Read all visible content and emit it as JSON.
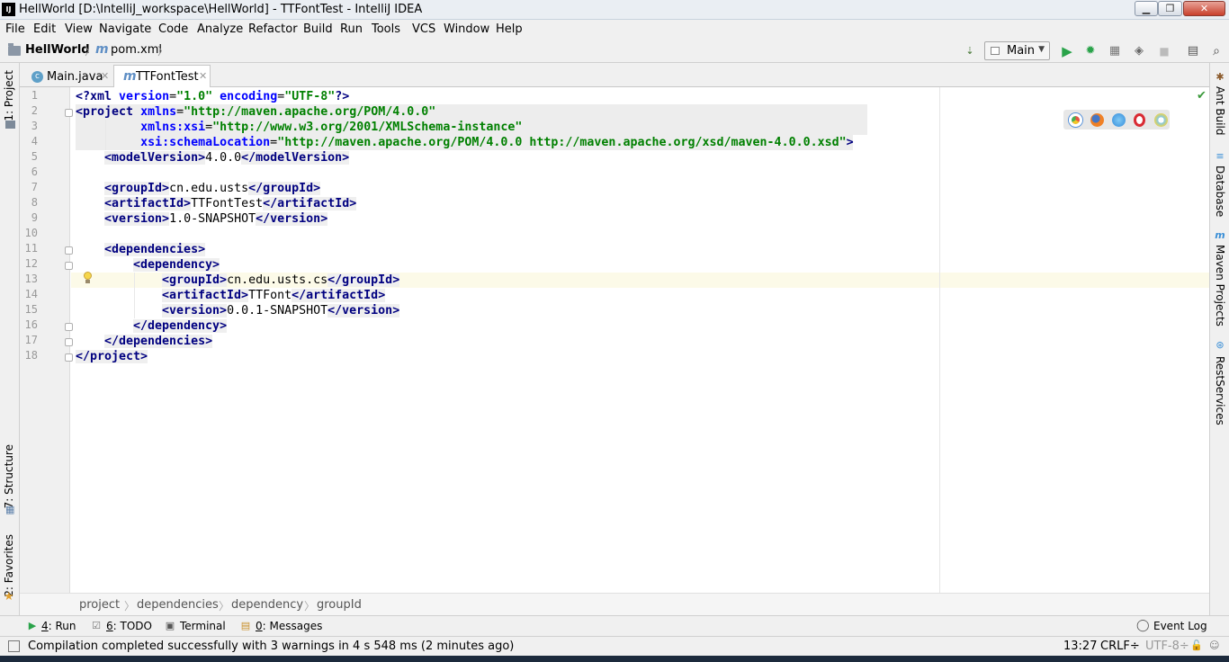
{
  "window": {
    "app_icon": "IJ",
    "title": "HellWorld [D:\\IntelliJ_workspace\\HellWorld] - TTFontTest - IntelliJ IDEA",
    "controls": [
      "minimize-icon",
      "maximize-icon",
      "close-icon"
    ]
  },
  "menu": {
    "items": [
      "File",
      "Edit",
      "View",
      "Navigate",
      "Code",
      "Analyze",
      "Refactor",
      "Build",
      "Run",
      "Tools",
      "VCS",
      "Window",
      "Help"
    ]
  },
  "nav": {
    "project": "HellWorld",
    "file": "pom.xml",
    "run_config": "Main",
    "toolbar_icons": [
      "build-icon",
      "run-icon",
      "debug-icon",
      "coverage-icon",
      "profile-icon",
      "stop-icon",
      "project-structure-icon",
      "search-everywhere-icon"
    ]
  },
  "tabs": [
    {
      "label": "Main.java",
      "icon": "class-icon",
      "active": false
    },
    {
      "label": "TTFontTest",
      "icon": "maven-icon",
      "active": true
    }
  ],
  "left_tools": [
    {
      "label": "1: Project"
    },
    {
      "label": "7: Structure"
    },
    {
      "label": "2: Favorites"
    }
  ],
  "right_tools": [
    {
      "label": "Ant Build"
    },
    {
      "label": "Database"
    },
    {
      "label": "Maven Projects"
    },
    {
      "label": "RestServices"
    }
  ],
  "editor": {
    "line_numbers": [
      "1",
      "2",
      "3",
      "4",
      "5",
      "6",
      "7",
      "8",
      "9",
      "10",
      "11",
      "12",
      "13",
      "14",
      "15",
      "16",
      "17",
      "18"
    ],
    "caret_line": 13,
    "browsers": [
      "chrome-icon",
      "firefox-icon",
      "safari-icon",
      "opera-icon",
      "ie-icon"
    ],
    "code": {
      "l1_a": "<?xml ",
      "l1_b": "version",
      "l1_c": "=",
      "l1_d": "\"1.0\"",
      "l1_e": " ",
      "l1_f": "encoding",
      "l1_g": "=",
      "l1_h": "\"UTF-8\"",
      "l1_i": "?>",
      "l2_a": "<project ",
      "l2_b": "xmlns",
      "l2_c": "=",
      "l2_d": "\"http://maven.apache.org/POM/4.0.0\"",
      "l3_a": "         ",
      "l3_b": "xmlns:xsi",
      "l3_c": "=",
      "l3_d": "\"http://www.w3.org/2001/XMLSchema-instance\"",
      "l4_a": "         ",
      "l4_b": "xsi:schemaLocation",
      "l4_c": "=",
      "l4_d": "\"http://maven.apache.org/POM/4.0.0 http://maven.apache.org/xsd/maven-4.0.0.xsd\"",
      "l4_e": ">",
      "l5_a": "<modelVersion>",
      "l5_b": "4.0.0",
      "l5_c": "</modelVersion>",
      "l7_a": "<groupId>",
      "l7_b": "cn.edu.usts",
      "l7_c": "</groupId>",
      "l8_a": "<artifactId>",
      "l8_b": "TTFontTest",
      "l8_c": "</artifactId>",
      "l9_a": "<version>",
      "l9_b": "1.0-SNAPSHOT",
      "l9_c": "</version>",
      "l11_a": "<dependencies>",
      "l12_a": "<dependency>",
      "l13_a": "<groupId>",
      "l13_b": "cn.edu.usts.cs",
      "l13_c": "</groupId>",
      "l14_a": "<artifactId>",
      "l14_b": "TTFont",
      "l14_c": "</artifactId>",
      "l15_a": "<version>",
      "l15_b": "0.0.1-SNAPSHOT",
      "l15_c": "</version>",
      "l16_a": "</dependency>",
      "l17_a": "</dependencies>",
      "l18_a": "</project>"
    }
  },
  "xml_breadcrumbs": [
    "project",
    "dependencies",
    "dependency",
    "groupId"
  ],
  "bottom_tools": [
    {
      "label_key": "4",
      "label": ": Run"
    },
    {
      "label_key": "6",
      "label": ": TODO"
    },
    {
      "label_key": "",
      "label": "Terminal"
    },
    {
      "label_key": "0",
      "label": ": Messages"
    }
  ],
  "event_log": "Event Log",
  "status": {
    "message": "Compilation completed successfully with 3 warnings in 4 s 548 ms (2 minutes ago)",
    "position": "13:27",
    "line_sep": "CRLF÷",
    "encoding": "UTF-8÷"
  }
}
